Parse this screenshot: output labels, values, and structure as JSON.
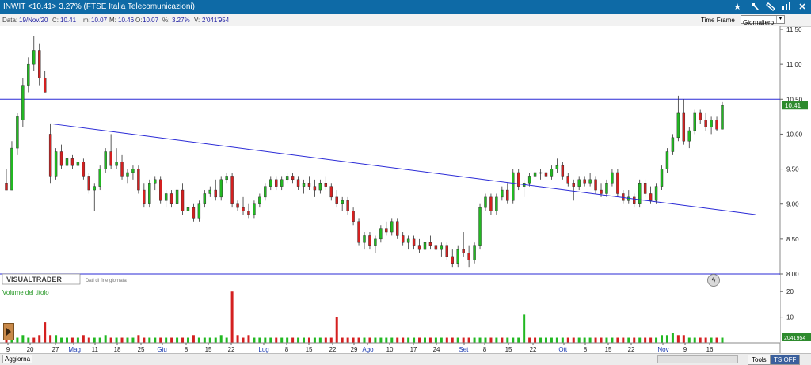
{
  "window": {
    "title": "INWIT <10.41> 3.27%  (FTSE Italia Telecomunicazioni)"
  },
  "info": {
    "data_label": "Data:",
    "data_value": "19/Nov/20",
    "c_label": "C:",
    "c_value": "10.41",
    "m_label": "m:",
    "m_value": "10.07",
    "M_label": "M:",
    "M_value": "10.46",
    "o_label": "O:",
    "o_value": "10.07",
    "pct_label": "%:",
    "pct_value": "3.27%",
    "vol_label": "V:",
    "vol_value": "2'041'954",
    "timeframe_label": "Time Frame",
    "timeframe_value": "Giornaliero"
  },
  "status": {
    "aggiorna": "Aggiorna",
    "tools": "Tools",
    "ts_off": "TS OFF"
  },
  "icons": [
    "star-icon",
    "hammer-icon",
    "ruler-icon",
    "bars-icon",
    "close-icon",
    "bolt-icon"
  ],
  "colors": {
    "up": "#22b822",
    "down": "#d42020",
    "trendline": "#2a2ad6",
    "hline": "#2a2ad6",
    "titlebar": "#0e6aa6"
  },
  "chart_data": {
    "type": "candlestick",
    "price_axis": {
      "min": 8.0,
      "max": 11.5,
      "ticks": [
        "11.50",
        "11.00",
        "10.50",
        "10.00",
        "9.50",
        "9.00",
        "8.50",
        "8.00"
      ]
    },
    "last_price_label": "10.41",
    "horizontal_line": 10.5,
    "watermark": "VISUALTRADER",
    "watermark_sub": "Dati di fine giornata",
    "volume_panel": {
      "title": "Volume del titolo",
      "ticks": [
        "20",
        "10"
      ],
      "last_label": "2041954"
    },
    "x_labels": [
      "9",
      "20",
      "27",
      "Mag",
      "11",
      "18",
      "25",
      "Giu",
      "8",
      "15",
      "22",
      "Lug",
      "8",
      "15",
      "22",
      "29",
      "Ago",
      "10",
      "17",
      "24",
      "Set",
      "8",
      "15",
      "22",
      "Ott",
      "8",
      "15",
      "22",
      "Nov",
      "9",
      "16"
    ],
    "trendline": {
      "start": {
        "bar": 8,
        "price": 10.15
      },
      "end": {
        "bar": 136,
        "price": 8.85
      }
    },
    "candles": [
      [
        9.3,
        9.5,
        9.2,
        9.2
      ],
      [
        9.2,
        9.9,
        9.2,
        9.8
      ],
      [
        9.8,
        10.3,
        9.7,
        10.25
      ],
      [
        10.2,
        10.8,
        10.1,
        10.7
      ],
      [
        10.7,
        11.1,
        10.6,
        11.0
      ],
      [
        11.0,
        11.4,
        10.9,
        11.2
      ],
      [
        11.2,
        11.3,
        10.7,
        10.8
      ],
      [
        10.8,
        10.9,
        10.6,
        10.6
      ],
      [
        10.0,
        10.15,
        9.3,
        9.4
      ],
      [
        9.4,
        9.8,
        9.35,
        9.75
      ],
      [
        9.75,
        9.85,
        9.5,
        9.55
      ],
      [
        9.55,
        9.7,
        9.45,
        9.65
      ],
      [
        9.65,
        9.7,
        9.5,
        9.55
      ],
      [
        9.55,
        9.7,
        9.5,
        9.6
      ],
      [
        9.6,
        9.65,
        9.35,
        9.4
      ],
      [
        9.4,
        9.45,
        9.15,
        9.2
      ],
      [
        9.2,
        9.3,
        8.9,
        9.25
      ],
      [
        9.25,
        9.55,
        9.2,
        9.5
      ],
      [
        9.5,
        9.8,
        9.45,
        9.75
      ],
      [
        9.75,
        10.0,
        9.5,
        9.55
      ],
      [
        9.55,
        9.8,
        9.5,
        9.6
      ],
      [
        9.6,
        9.7,
        9.35,
        9.4
      ],
      [
        9.4,
        9.5,
        9.3,
        9.45
      ],
      [
        9.45,
        9.55,
        9.35,
        9.5
      ],
      [
        9.5,
        9.55,
        9.15,
        9.2
      ],
      [
        9.2,
        9.3,
        8.95,
        9.0
      ],
      [
        9.0,
        9.35,
        8.95,
        9.3
      ],
      [
        9.3,
        9.4,
        9.2,
        9.35
      ],
      [
        9.35,
        9.4,
        9.0,
        9.05
      ],
      [
        9.05,
        9.2,
        8.95,
        9.15
      ],
      [
        9.15,
        9.2,
        8.95,
        9.0
      ],
      [
        9.0,
        9.25,
        8.9,
        9.2
      ],
      [
        9.2,
        9.3,
        8.85,
        8.9
      ],
      [
        8.9,
        9.0,
        8.8,
        8.95
      ],
      [
        8.95,
        9.0,
        8.75,
        8.8
      ],
      [
        8.8,
        9.05,
        8.75,
        9.0
      ],
      [
        9.0,
        9.2,
        8.95,
        9.15
      ],
      [
        9.15,
        9.25,
        9.1,
        9.2
      ],
      [
        9.2,
        9.35,
        9.05,
        9.1
      ],
      [
        9.1,
        9.4,
        9.05,
        9.35
      ],
      [
        9.35,
        9.45,
        9.3,
        9.4
      ],
      [
        9.4,
        9.45,
        8.95,
        9.0
      ],
      [
        9.0,
        9.05,
        8.9,
        8.95
      ],
      [
        8.95,
        9.1,
        8.85,
        8.9
      ],
      [
        8.9,
        9.0,
        8.8,
        8.85
      ],
      [
        8.85,
        9.05,
        8.8,
        9.0
      ],
      [
        9.0,
        9.15,
        8.95,
        9.1
      ],
      [
        9.1,
        9.3,
        9.05,
        9.25
      ],
      [
        9.25,
        9.4,
        9.2,
        9.35
      ],
      [
        9.35,
        9.4,
        9.2,
        9.25
      ],
      [
        9.25,
        9.4,
        9.2,
        9.35
      ],
      [
        9.35,
        9.45,
        9.3,
        9.4
      ],
      [
        9.4,
        9.45,
        9.3,
        9.35
      ],
      [
        9.35,
        9.4,
        9.2,
        9.25
      ],
      [
        9.25,
        9.35,
        9.15,
        9.3
      ],
      [
        9.3,
        9.4,
        9.2,
        9.25
      ],
      [
        9.25,
        9.35,
        9.1,
        9.2
      ],
      [
        9.2,
        9.35,
        9.15,
        9.3
      ],
      [
        9.3,
        9.4,
        9.2,
        9.25
      ],
      [
        9.25,
        9.3,
        9.05,
        9.1
      ],
      [
        9.1,
        9.2,
        8.95,
        9.0
      ],
      [
        9.0,
        9.1,
        8.9,
        9.05
      ],
      [
        9.05,
        9.1,
        8.85,
        8.9
      ],
      [
        8.9,
        8.95,
        8.7,
        8.75
      ],
      [
        8.75,
        8.8,
        8.4,
        8.45
      ],
      [
        8.45,
        8.6,
        8.35,
        8.55
      ],
      [
        8.55,
        8.6,
        8.35,
        8.4
      ],
      [
        8.4,
        8.55,
        8.3,
        8.5
      ],
      [
        8.5,
        8.7,
        8.45,
        8.65
      ],
      [
        8.65,
        8.75,
        8.55,
        8.6
      ],
      [
        8.6,
        8.8,
        8.55,
        8.75
      ],
      [
        8.75,
        8.8,
        8.5,
        8.55
      ],
      [
        8.55,
        8.6,
        8.4,
        8.45
      ],
      [
        8.45,
        8.55,
        8.35,
        8.5
      ],
      [
        8.5,
        8.55,
        8.35,
        8.4
      ],
      [
        8.4,
        8.5,
        8.3,
        8.35
      ],
      [
        8.35,
        8.5,
        8.3,
        8.45
      ],
      [
        8.45,
        8.55,
        8.35,
        8.4
      ],
      [
        8.4,
        8.5,
        8.3,
        8.35
      ],
      [
        8.35,
        8.45,
        8.25,
        8.4
      ],
      [
        8.4,
        8.45,
        8.2,
        8.25
      ],
      [
        8.25,
        8.35,
        8.1,
        8.15
      ],
      [
        8.15,
        8.4,
        8.1,
        8.35
      ],
      [
        8.35,
        8.6,
        8.25,
        8.3
      ],
      [
        8.3,
        8.4,
        8.1,
        8.2
      ],
      [
        8.2,
        8.45,
        8.15,
        8.4
      ],
      [
        8.4,
        9.0,
        8.35,
        8.95
      ],
      [
        8.95,
        9.15,
        8.9,
        9.1
      ],
      [
        9.1,
        9.15,
        8.85,
        8.9
      ],
      [
        8.9,
        9.15,
        8.85,
        9.1
      ],
      [
        9.1,
        9.25,
        9.05,
        9.2
      ],
      [
        9.2,
        9.3,
        9.0,
        9.05
      ],
      [
        9.05,
        9.5,
        9.0,
        9.45
      ],
      [
        9.45,
        9.5,
        9.2,
        9.25
      ],
      [
        9.25,
        9.35,
        9.1,
        9.3
      ],
      [
        9.3,
        9.45,
        9.25,
        9.4
      ],
      [
        9.4,
        9.5,
        9.35,
        9.45
      ],
      [
        9.45,
        9.5,
        9.35,
        9.45
      ],
      [
        9.45,
        9.5,
        9.35,
        9.4
      ],
      [
        9.4,
        9.55,
        9.35,
        9.5
      ],
      [
        9.5,
        9.65,
        9.45,
        9.55
      ],
      [
        9.55,
        9.6,
        9.35,
        9.4
      ],
      [
        9.4,
        9.45,
        9.25,
        9.3
      ],
      [
        9.3,
        9.35,
        9.05,
        9.25
      ],
      [
        9.25,
        9.4,
        9.2,
        9.35
      ],
      [
        9.35,
        9.4,
        9.25,
        9.3
      ],
      [
        9.3,
        9.45,
        9.25,
        9.35
      ],
      [
        9.35,
        9.4,
        9.15,
        9.2
      ],
      [
        9.2,
        9.3,
        9.1,
        9.15
      ],
      [
        9.15,
        9.35,
        9.1,
        9.3
      ],
      [
        9.3,
        9.5,
        9.25,
        9.45
      ],
      [
        9.45,
        9.5,
        9.1,
        9.15
      ],
      [
        9.15,
        9.2,
        9.0,
        9.05
      ],
      [
        9.05,
        9.2,
        9.0,
        9.1
      ],
      [
        9.1,
        9.15,
        8.95,
        9.0
      ],
      [
        9.0,
        9.35,
        8.95,
        9.3
      ],
      [
        9.3,
        9.35,
        9.1,
        9.15
      ],
      [
        9.15,
        9.25,
        9.0,
        9.05
      ],
      [
        9.05,
        9.3,
        9.0,
        9.25
      ],
      [
        9.25,
        9.55,
        9.2,
        9.5
      ],
      [
        9.5,
        9.8,
        9.45,
        9.75
      ],
      [
        9.75,
        10.0,
        9.7,
        9.95
      ],
      [
        9.95,
        10.55,
        9.9,
        10.3
      ],
      [
        10.3,
        10.5,
        9.85,
        9.9
      ],
      [
        9.9,
        10.1,
        9.8,
        10.05
      ],
      [
        10.05,
        10.35,
        10.0,
        10.3
      ],
      [
        10.3,
        10.35,
        10.15,
        10.2
      ],
      [
        10.2,
        10.3,
        10.05,
        10.1
      ],
      [
        10.1,
        10.25,
        10.0,
        10.2
      ],
      [
        10.2,
        10.25,
        10.05,
        10.07
      ],
      [
        10.07,
        10.46,
        10.07,
        10.41
      ]
    ],
    "volume": [
      [
        2,
        0
      ],
      [
        3,
        1
      ],
      [
        2,
        1
      ],
      [
        3,
        1
      ],
      [
        2,
        1
      ],
      [
        2,
        0
      ],
      [
        3,
        0
      ],
      [
        8,
        0
      ],
      [
        3,
        0
      ],
      [
        3,
        1
      ],
      [
        2,
        1
      ],
      [
        2,
        1
      ],
      [
        2,
        0
      ],
      [
        2,
        1
      ],
      [
        3,
        0
      ],
      [
        2,
        0
      ],
      [
        2,
        1
      ],
      [
        2,
        1
      ],
      [
        3,
        1
      ],
      [
        2,
        0
      ],
      [
        2,
        1
      ],
      [
        2,
        0
      ],
      [
        2,
        1
      ],
      [
        2,
        1
      ],
      [
        3,
        0
      ],
      [
        2,
        0
      ],
      [
        2,
        1
      ],
      [
        2,
        1
      ],
      [
        2,
        0
      ],
      [
        2,
        1
      ],
      [
        2,
        0
      ],
      [
        2,
        1
      ],
      [
        2,
        0
      ],
      [
        2,
        1
      ],
      [
        3,
        0
      ],
      [
        2,
        1
      ],
      [
        2,
        1
      ],
      [
        2,
        1
      ],
      [
        2,
        1
      ],
      [
        3,
        1
      ],
      [
        2,
        1
      ],
      [
        20,
        0
      ],
      [
        3,
        0
      ],
      [
        2,
        0
      ],
      [
        3,
        0
      ],
      [
        2,
        1
      ],
      [
        2,
        1
      ],
      [
        2,
        1
      ],
      [
        2,
        1
      ],
      [
        2,
        0
      ],
      [
        2,
        1
      ],
      [
        2,
        1
      ],
      [
        2,
        0
      ],
      [
        2,
        1
      ],
      [
        2,
        1
      ],
      [
        2,
        0
      ],
      [
        2,
        1
      ],
      [
        2,
        1
      ],
      [
        2,
        0
      ],
      [
        2,
        0
      ],
      [
        10,
        0
      ],
      [
        2,
        0
      ],
      [
        2,
        0
      ],
      [
        2,
        0
      ],
      [
        2,
        0
      ],
      [
        2,
        1
      ],
      [
        2,
        0
      ],
      [
        2,
        1
      ],
      [
        2,
        1
      ],
      [
        2,
        1
      ],
      [
        2,
        1
      ],
      [
        2,
        0
      ],
      [
        2,
        0
      ],
      [
        2,
        1
      ],
      [
        2,
        1
      ],
      [
        2,
        0
      ],
      [
        2,
        1
      ],
      [
        2,
        0
      ],
      [
        2,
        1
      ],
      [
        2,
        1
      ],
      [
        2,
        0
      ],
      [
        2,
        0
      ],
      [
        2,
        1
      ],
      [
        2,
        0
      ],
      [
        2,
        0
      ],
      [
        2,
        1
      ],
      [
        2,
        1
      ],
      [
        2,
        1
      ],
      [
        2,
        0
      ],
      [
        2,
        1
      ],
      [
        2,
        0
      ],
      [
        2,
        1
      ],
      [
        2,
        1
      ],
      [
        2,
        1
      ],
      [
        11,
        1
      ],
      [
        2,
        0
      ],
      [
        2,
        0
      ],
      [
        2,
        1
      ],
      [
        2,
        1
      ],
      [
        2,
        1
      ],
      [
        2,
        1
      ],
      [
        2,
        1
      ],
      [
        2,
        0
      ],
      [
        2,
        0
      ],
      [
        2,
        1
      ],
      [
        2,
        1
      ],
      [
        2,
        1
      ],
      [
        2,
        0
      ],
      [
        2,
        0
      ],
      [
        2,
        1
      ],
      [
        2,
        1
      ],
      [
        2,
        0
      ],
      [
        2,
        0
      ],
      [
        2,
        1
      ],
      [
        2,
        0
      ],
      [
        2,
        1
      ],
      [
        2,
        0
      ],
      [
        2,
        0
      ],
      [
        2,
        1
      ],
      [
        3,
        1
      ],
      [
        3,
        1
      ],
      [
        4,
        1
      ],
      [
        3,
        0
      ],
      [
        3,
        0
      ],
      [
        2,
        1
      ],
      [
        2,
        1
      ],
      [
        2,
        0
      ],
      [
        2,
        0
      ],
      [
        2,
        1
      ],
      [
        2,
        0
      ],
      [
        2,
        1
      ]
    ]
  }
}
